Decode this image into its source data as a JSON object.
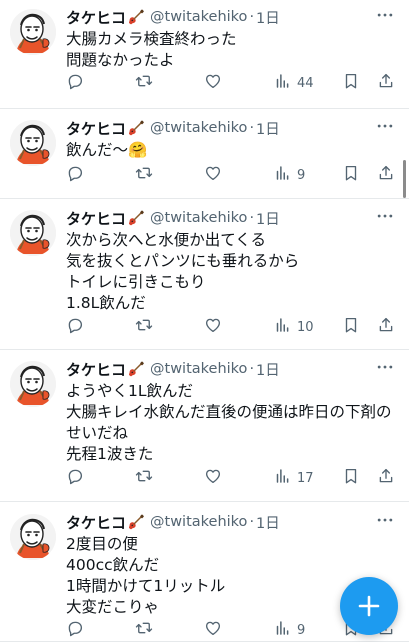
{
  "author": {
    "name": "タケヒコ",
    "handle": "@twitakehiko",
    "separator": "·",
    "avatar_icon": "caricature-avatar-icon",
    "badge_icon": "guitar-icon"
  },
  "tweets": [
    {
      "time": "1日",
      "text": "大腸カメラ検査終わった\n問題なかったよ",
      "views": "44"
    },
    {
      "time": "1日",
      "text": "飲んだ〜🤗",
      "views": "9"
    },
    {
      "time": "1日",
      "text": "次から次へと水便か出てくる\n気を抜くとパンツにも垂れるから\nトイレに引きこもり\n1.8L飲んだ",
      "views": "10"
    },
    {
      "time": "1日",
      "text": "ようやく1L飲んだ\n大腸キレイ水飲んだ直後の便通は昨日の下剤のせいだね\n先程1波きた",
      "views": "17"
    },
    {
      "time": "1日",
      "text": "2度目の便\n400cc飲んだ\n1時間かけて1リットル\n大変だこりゃ",
      "views": "9"
    }
  ],
  "icons": {
    "reply": "reply-icon",
    "retweet": "retweet-icon",
    "like": "like-icon",
    "views": "views-icon",
    "bookmark": "bookmark-icon",
    "share": "share-icon",
    "more": "more-icon",
    "compose": "compose-plus-icon"
  },
  "colors": {
    "accent": "#1d9bf0",
    "text": "#0f1419",
    "secondary": "#536471",
    "divider": "#e6e9eb"
  }
}
